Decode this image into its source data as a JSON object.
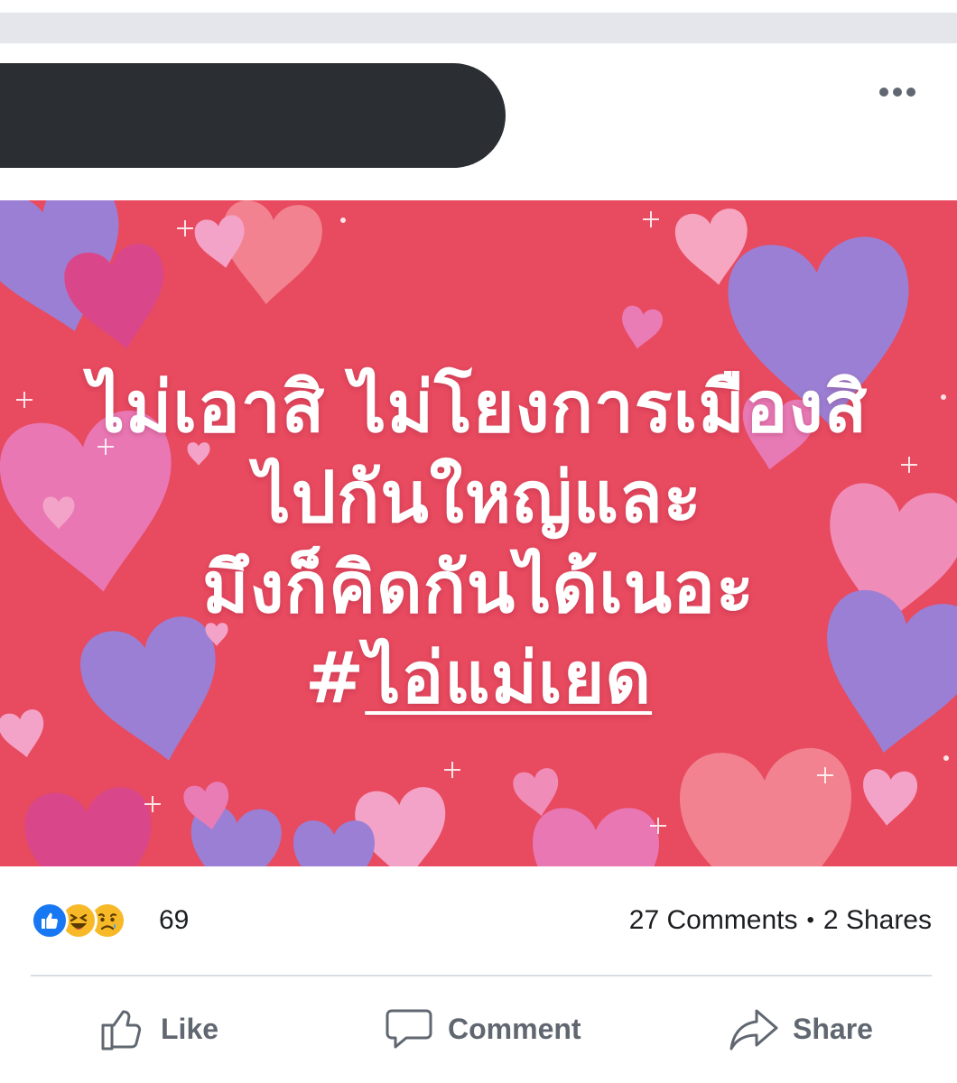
{
  "post": {
    "menu_icon": "more-horizontal-icon",
    "image": {
      "lines": [
        "ไม่เอาสิ ไม่โยงการเมืองสิ",
        "ไปกันใหญ่และ",
        "มึงก็คิดกันได้เนอะ"
      ],
      "hashtag_prefix": "#",
      "hashtag": "ไอ่แม่เยด",
      "background_color": "#e84a5f"
    },
    "reactions": {
      "icons": [
        "like-reaction-icon",
        "haha-reaction-icon",
        "sad-reaction-icon"
      ],
      "count": "69"
    },
    "stats": {
      "comments": "27 Comments",
      "separator": "•",
      "shares": "2 Shares"
    },
    "actions": {
      "like_label": "Like",
      "comment_label": "Comment",
      "share_label": "Share"
    }
  },
  "colors": {
    "like_blue": "#1877f2",
    "emoji_yellow": "#f7b928",
    "action_gray": "#606770"
  }
}
